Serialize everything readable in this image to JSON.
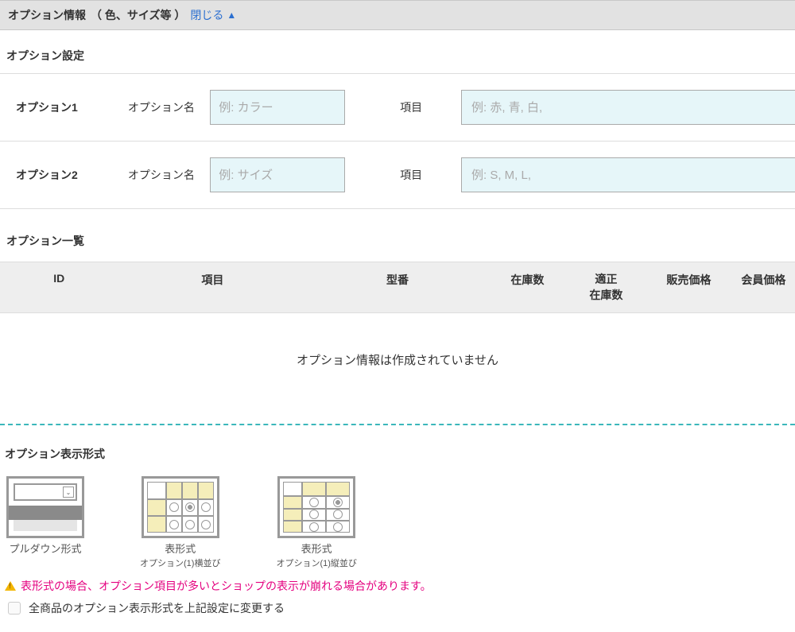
{
  "header": {
    "title": "オプション情報",
    "paren": "（ 色、サイズ等 ）",
    "close_label": "閉じる",
    "close_arrow": "▲"
  },
  "settings": {
    "section_title": "オプション設定",
    "rows": [
      {
        "label": "オプション1",
        "name_label": "オプション名",
        "name_placeholder": "例: カラー",
        "item_label": "項目",
        "item_placeholder": "例: 赤, 青, 白,"
      },
      {
        "label": "オプション2",
        "name_label": "オプション名",
        "name_placeholder": "例: サイズ",
        "item_label": "項目",
        "item_placeholder": "例: S, M, L,"
      }
    ]
  },
  "list": {
    "section_title": "オプション一覧",
    "columns": {
      "id": "ID",
      "item": "項目",
      "model": "型番",
      "stock": "在庫数",
      "proper_stock": "適正\n在庫数",
      "price": "販売価格",
      "member_price": "会員価格"
    },
    "empty_msg": "オプション情報は作成されていません"
  },
  "display_format": {
    "section_title": "オプション表示形式",
    "options": [
      {
        "caption": "プルダウン形式",
        "sub": ""
      },
      {
        "caption": "表形式",
        "sub": "オプション(1)横並び"
      },
      {
        "caption": "表形式",
        "sub": "オプション(1)縦並び"
      }
    ],
    "warning": "表形式の場合、オプション項目が多いとショップの表示が崩れる場合があります。",
    "checkbox_label": "全商品のオプション表示形式を上記設定に変更する"
  }
}
